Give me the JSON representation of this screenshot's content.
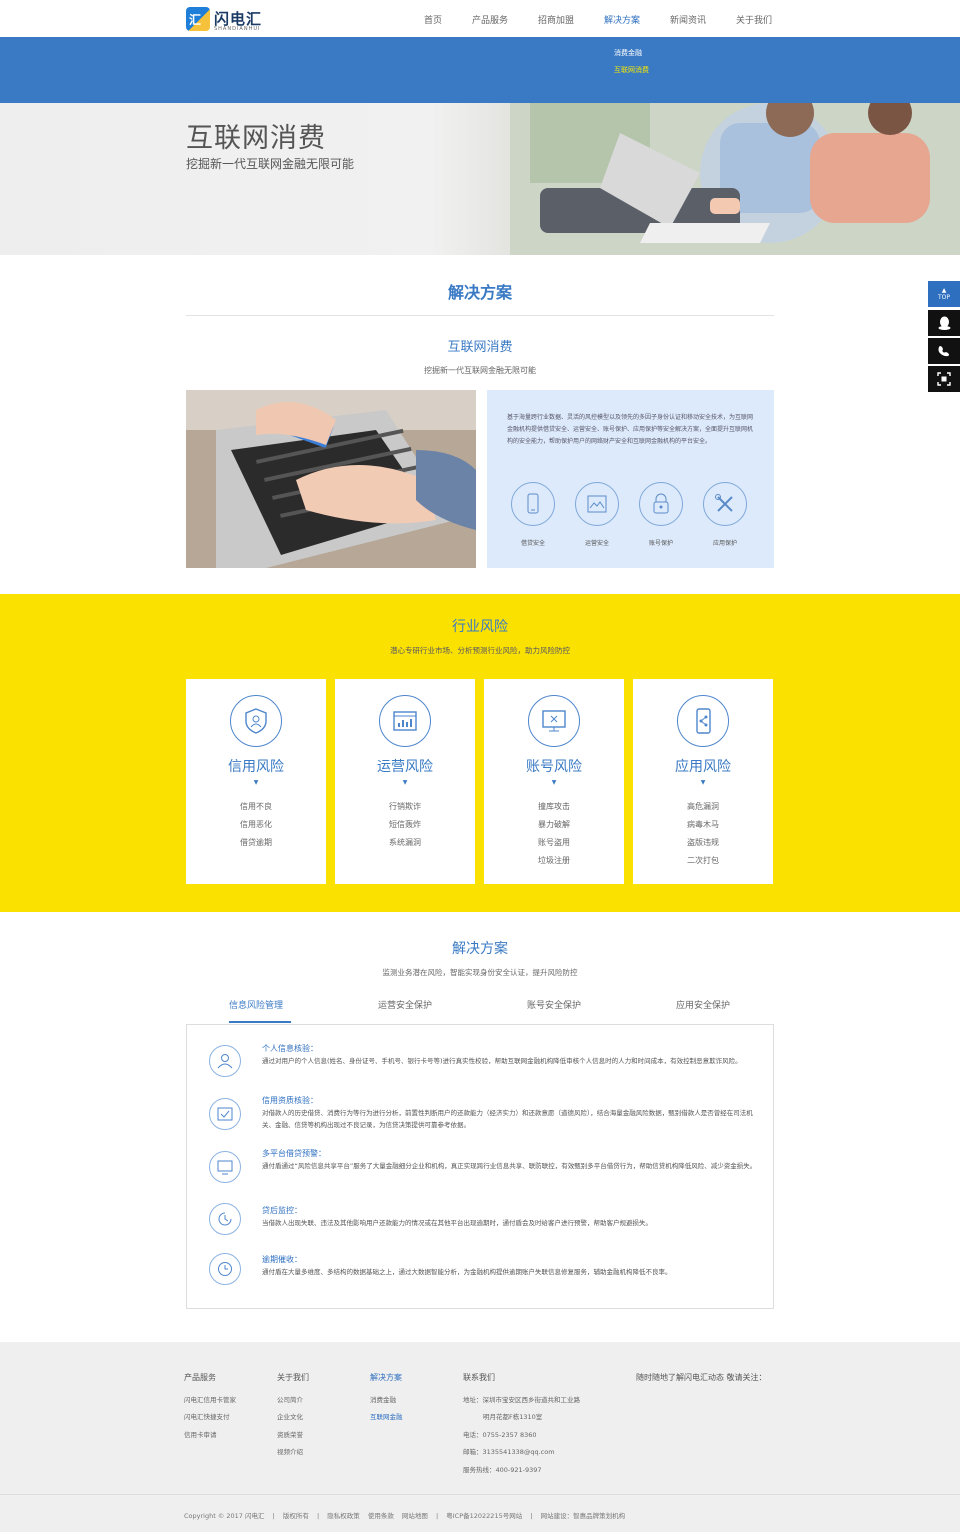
{
  "header": {
    "logo_name": "闪电汇",
    "logo_sub": "SHANDIANHUI",
    "nav": [
      "首页",
      "产品服务",
      "招商加盟",
      "解决方案",
      "新闻资讯",
      "关于我们"
    ],
    "active_nav": "解决方案",
    "dropdown": [
      "消费金融",
      "互联网消费"
    ]
  },
  "hero": {
    "title": "互联网消费",
    "subtitle": "挖掘新一代互联网金融无限可能"
  },
  "side": {
    "top_label": "TOP"
  },
  "section1": {
    "title": "解决方案",
    "subtitle": "互联网消费",
    "tagline": "挖掘新一代互联网金融无限可能",
    "info_text": "基于海量跨行业数据、灵活的风控模型以及领先的多因子身份认证和移动安全技术，为互联网金融机构提供借贷安全、运营安全、账号保护、应用保护等安全解决方案，全面提升互联网机构的安全能力，帮助保护用户的网络财产安全和互联网金融机构的平台安全。",
    "icons": [
      {
        "label": "借贷安全",
        "icon": "phone-icon"
      },
      {
        "label": "运营安全",
        "icon": "document-icon"
      },
      {
        "label": "账号保护",
        "icon": "lock-icon"
      },
      {
        "label": "应用保护",
        "icon": "tools-icon"
      }
    ]
  },
  "risk": {
    "title": "行业风险",
    "subtitle": "潜心专研行业市场、分析预测行业风险，助力风险防控",
    "cards": [
      {
        "title": "信用风险",
        "icon": "shield-user-icon",
        "items": [
          "信用不良",
          "信用恶化",
          "借贷逾期"
        ]
      },
      {
        "title": "运营风险",
        "icon": "chart-window-icon",
        "items": [
          "行销欺诈",
          "短信轰炸",
          "系统漏洞"
        ]
      },
      {
        "title": "账号风险",
        "icon": "monitor-x-icon",
        "items": [
          "撞库攻击",
          "暴力破解",
          "账号盗用",
          "垃圾注册"
        ]
      },
      {
        "title": "应用风险",
        "icon": "phone-share-icon",
        "items": [
          "高危漏洞",
          "病毒木马",
          "盗版违规",
          "二次打包"
        ]
      }
    ]
  },
  "solutions": {
    "title": "解决方案",
    "subtitle": "监测业务潜在风险，智能实现身份安全认证，提升风险防控",
    "tabs": [
      "信息风险管理",
      "运营安全保护",
      "账号安全保护",
      "应用安全保护"
    ],
    "rows": [
      {
        "title": "个人信息核验：",
        "icon": "user-icon",
        "text": "通过对用户的个人信息(姓名、身份证号、手机号、银行卡号等)进行真实性校验，帮助互联网金融机构降低审核个人信息时的人力和时间成本，有效控制恶意欺诈风险。"
      },
      {
        "title": "信用资质核验：",
        "icon": "check-card-icon",
        "text": "对借款人的历史借贷、消费行为等行为进行分析，前置性判断用户的还款能力（经济实力）和还款意愿（道德风险），结合海量金融风险数据，甄别借款人是否曾经在司法机关、金融、信贷等机构出现过不良记录，为信贷决策提供可靠参考依据。"
      },
      {
        "title": "多平台借贷预警：",
        "icon": "monitor-icon",
        "text": "通付盾通过“风险信息共享平台”服务了大量金融细分企业和机构，真正实现跨行业信息共享、联防联控，有效甄别多平台借贷行为，帮助信贷机构降低风险、减少资金损失。"
      },
      {
        "title": "贷后监控：",
        "icon": "refresh-clock-icon",
        "text": "当借款人出现失联、违法及其他影响用户还款能力的情况或在其他平台出现逾期时，通付盾会及时给客户进行预警，帮助客户规避损失。"
      },
      {
        "title": "逾期催收：",
        "icon": "clock-icon",
        "text": "通付盾在大量多维度、多结构的数据基础之上，通过大数据智能分析，为金融机构提供逾期账户失联信息修复服务，辅助金融机构降低不良率。"
      }
    ]
  },
  "footer": {
    "cols": [
      {
        "head": "产品服务",
        "links": [
          "闪电汇信用卡管家",
          "闪电汇快捷支付",
          "信用卡审请"
        ]
      },
      {
        "head": "关于我们",
        "links": [
          "公司简介",
          "企业文化",
          "资质荣誉",
          "视频介绍"
        ]
      },
      {
        "head": "解决方案",
        "links": [
          "消费金融",
          "互联网金融"
        ]
      },
      {
        "head": "联系我们",
        "links": [
          "地址：深圳市宝安区西乡街道共和工业路",
          "明月花都F栋1310室",
          "电话：0755-2357 8360",
          "邮箱：3135541338@qq.com",
          "服务热线：400-921-9397"
        ]
      }
    ],
    "follow": "随时随地了解闪电汇动态 敬请关注：",
    "bottom": [
      "Copyright © 2017 闪电汇",
      "|",
      "版权所有",
      "|",
      "隐私权政策",
      "使用条款",
      "网站地图",
      "|",
      "粤ICP备12022215号网站",
      "|",
      "网站建设：智惠品牌策划机构"
    ]
  },
  "colors": {
    "accent": "#3a7ac4",
    "yellow": "#fbe100",
    "panel": "#ddeafb"
  }
}
